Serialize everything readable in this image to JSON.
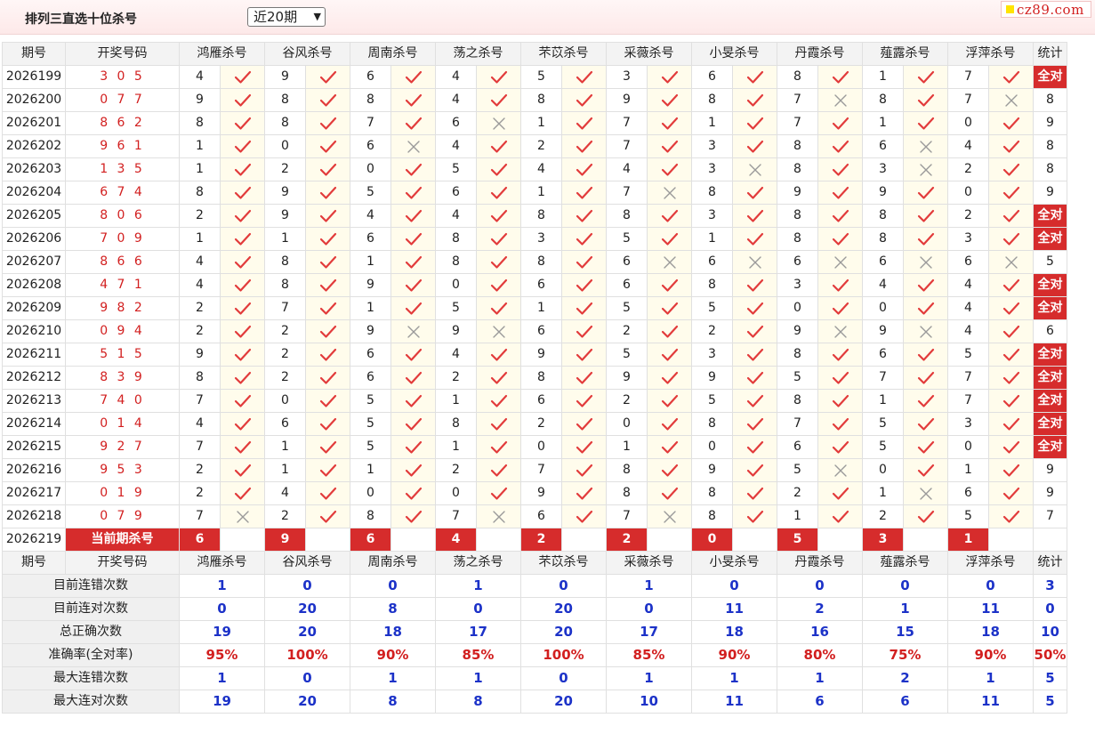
{
  "title": "排列三直选十位杀号",
  "period_select": {
    "value": "近20期"
  },
  "logo": {
    "text": "cz89.com"
  },
  "header": {
    "period": "期号",
    "code": "开奖号码",
    "experts": [
      "鸿雁杀号",
      "谷风杀号",
      "周南杀号",
      "荡之杀号",
      "芣苡杀号",
      "采薇杀号",
      "小旻杀号",
      "丹霞杀号",
      "薤露杀号",
      "浮萍杀号"
    ],
    "stat": "统计"
  },
  "rows": [
    {
      "period": "2026199",
      "code": "3 0 5",
      "picks": [
        4,
        9,
        6,
        4,
        5,
        3,
        6,
        8,
        1,
        7
      ],
      "ok": [
        1,
        1,
        1,
        1,
        1,
        1,
        1,
        1,
        1,
        1
      ],
      "stat": "全对"
    },
    {
      "period": "2026200",
      "code": "0 7 7",
      "picks": [
        9,
        8,
        8,
        4,
        8,
        9,
        8,
        7,
        8,
        7
      ],
      "ok": [
        1,
        1,
        1,
        1,
        1,
        1,
        1,
        0,
        1,
        0
      ],
      "stat": "8"
    },
    {
      "period": "2026201",
      "code": "8 6 2",
      "picks": [
        8,
        8,
        7,
        6,
        1,
        7,
        1,
        7,
        1,
        0
      ],
      "ok": [
        1,
        1,
        1,
        0,
        1,
        1,
        1,
        1,
        1,
        1
      ],
      "stat": "9"
    },
    {
      "period": "2026202",
      "code": "9 6 1",
      "picks": [
        1,
        0,
        6,
        4,
        2,
        7,
        3,
        8,
        6,
        4
      ],
      "ok": [
        1,
        1,
        0,
        1,
        1,
        1,
        1,
        1,
        0,
        1
      ],
      "stat": "8"
    },
    {
      "period": "2026203",
      "code": "1 3 5",
      "picks": [
        1,
        2,
        0,
        5,
        4,
        4,
        3,
        8,
        3,
        2
      ],
      "ok": [
        1,
        1,
        1,
        1,
        1,
        1,
        0,
        1,
        0,
        1
      ],
      "stat": "8"
    },
    {
      "period": "2026204",
      "code": "6 7 4",
      "picks": [
        8,
        9,
        5,
        6,
        1,
        7,
        8,
        9,
        9,
        0
      ],
      "ok": [
        1,
        1,
        1,
        1,
        1,
        0,
        1,
        1,
        1,
        1
      ],
      "stat": "9"
    },
    {
      "period": "2026205",
      "code": "8 0 6",
      "picks": [
        2,
        9,
        4,
        4,
        8,
        8,
        3,
        8,
        8,
        2
      ],
      "ok": [
        1,
        1,
        1,
        1,
        1,
        1,
        1,
        1,
        1,
        1
      ],
      "stat": "全对"
    },
    {
      "period": "2026206",
      "code": "7 0 9",
      "picks": [
        1,
        1,
        6,
        8,
        3,
        5,
        1,
        8,
        8,
        3
      ],
      "ok": [
        1,
        1,
        1,
        1,
        1,
        1,
        1,
        1,
        1,
        1
      ],
      "stat": "全对"
    },
    {
      "period": "2026207",
      "code": "8 6 6",
      "picks": [
        4,
        8,
        1,
        8,
        8,
        6,
        6,
        6,
        6,
        6
      ],
      "ok": [
        1,
        1,
        1,
        1,
        1,
        0,
        0,
        0,
        0,
        0
      ],
      "stat": "5"
    },
    {
      "period": "2026208",
      "code": "4 7 1",
      "picks": [
        4,
        8,
        9,
        0,
        6,
        6,
        8,
        3,
        4,
        4
      ],
      "ok": [
        1,
        1,
        1,
        1,
        1,
        1,
        1,
        1,
        1,
        1
      ],
      "stat": "全对"
    },
    {
      "period": "2026209",
      "code": "9 8 2",
      "picks": [
        2,
        7,
        1,
        5,
        1,
        5,
        5,
        0,
        0,
        4
      ],
      "ok": [
        1,
        1,
        1,
        1,
        1,
        1,
        1,
        1,
        1,
        1
      ],
      "stat": "全对"
    },
    {
      "period": "2026210",
      "code": "0 9 4",
      "picks": [
        2,
        2,
        9,
        9,
        6,
        2,
        2,
        9,
        9,
        4
      ],
      "ok": [
        1,
        1,
        0,
        0,
        1,
        1,
        1,
        0,
        0,
        1
      ],
      "stat": "6"
    },
    {
      "period": "2026211",
      "code": "5 1 5",
      "picks": [
        9,
        2,
        6,
        4,
        9,
        5,
        3,
        8,
        6,
        5
      ],
      "ok": [
        1,
        1,
        1,
        1,
        1,
        1,
        1,
        1,
        1,
        1
      ],
      "stat": "全对"
    },
    {
      "period": "2026212",
      "code": "8 3 9",
      "picks": [
        8,
        2,
        6,
        2,
        8,
        9,
        9,
        5,
        7,
        7
      ],
      "ok": [
        1,
        1,
        1,
        1,
        1,
        1,
        1,
        1,
        1,
        1
      ],
      "stat": "全对"
    },
    {
      "period": "2026213",
      "code": "7 4 0",
      "picks": [
        7,
        0,
        5,
        1,
        6,
        2,
        5,
        8,
        1,
        7
      ],
      "ok": [
        1,
        1,
        1,
        1,
        1,
        1,
        1,
        1,
        1,
        1
      ],
      "stat": "全对"
    },
    {
      "period": "2026214",
      "code": "0 1 4",
      "picks": [
        4,
        6,
        5,
        8,
        2,
        0,
        8,
        7,
        5,
        3
      ],
      "ok": [
        1,
        1,
        1,
        1,
        1,
        1,
        1,
        1,
        1,
        1
      ],
      "stat": "全对"
    },
    {
      "period": "2026215",
      "code": "9 2 7",
      "picks": [
        7,
        1,
        5,
        1,
        0,
        1,
        0,
        6,
        5,
        0
      ],
      "ok": [
        1,
        1,
        1,
        1,
        1,
        1,
        1,
        1,
        1,
        1
      ],
      "stat": "全对"
    },
    {
      "period": "2026216",
      "code": "9 5 3",
      "picks": [
        2,
        1,
        1,
        2,
        7,
        8,
        9,
        5,
        0,
        1
      ],
      "ok": [
        1,
        1,
        1,
        1,
        1,
        1,
        1,
        0,
        1,
        1
      ],
      "stat": "9"
    },
    {
      "period": "2026217",
      "code": "0 1 9",
      "picks": [
        2,
        4,
        0,
        0,
        9,
        8,
        8,
        2,
        1,
        6
      ],
      "ok": [
        1,
        1,
        1,
        1,
        1,
        1,
        1,
        1,
        0,
        1
      ],
      "stat": "9"
    },
    {
      "period": "2026218",
      "code": "0 7 9",
      "picks": [
        7,
        2,
        8,
        7,
        6,
        7,
        8,
        1,
        2,
        5
      ],
      "ok": [
        0,
        1,
        1,
        0,
        1,
        0,
        1,
        1,
        1,
        1
      ],
      "stat": "7"
    }
  ],
  "current": {
    "period": "2026219",
    "label": "当前期杀号",
    "picks": [
      "6",
      "9",
      "6",
      "4",
      "2",
      "2",
      "0",
      "5",
      "3",
      "1"
    ]
  },
  "summary": [
    {
      "label": "目前连错次数",
      "values": [
        "1",
        "0",
        "0",
        "1",
        "0",
        "1",
        "0",
        "0",
        "0",
        "0"
      ],
      "stat": "3"
    },
    {
      "label": "目前连对次数",
      "values": [
        "0",
        "20",
        "8",
        "0",
        "20",
        "0",
        "11",
        "2",
        "1",
        "11"
      ],
      "stat": "0"
    },
    {
      "label": "总正确次数",
      "values": [
        "19",
        "20",
        "18",
        "17",
        "20",
        "17",
        "18",
        "16",
        "15",
        "18"
      ],
      "stat": "10"
    },
    {
      "label": "准确率(全对率)",
      "values": [
        "95%",
        "100%",
        "90%",
        "85%",
        "100%",
        "85%",
        "90%",
        "80%",
        "75%",
        "90%"
      ],
      "stat": "50%"
    },
    {
      "label": "最大连错次数",
      "values": [
        "1",
        "0",
        "1",
        "1",
        "0",
        "1",
        "1",
        "1",
        "2",
        "1"
      ],
      "stat": "5"
    },
    {
      "label": "最大连对次数",
      "values": [
        "19",
        "20",
        "8",
        "8",
        "20",
        "10",
        "11",
        "6",
        "6",
        "11"
      ],
      "stat": "5"
    }
  ],
  "colors": {
    "accent_red": "#d62c2c",
    "check_red": "#e23b3b",
    "cross_gray": "#9a9a9a",
    "summary_blue": "#1c32c8"
  }
}
